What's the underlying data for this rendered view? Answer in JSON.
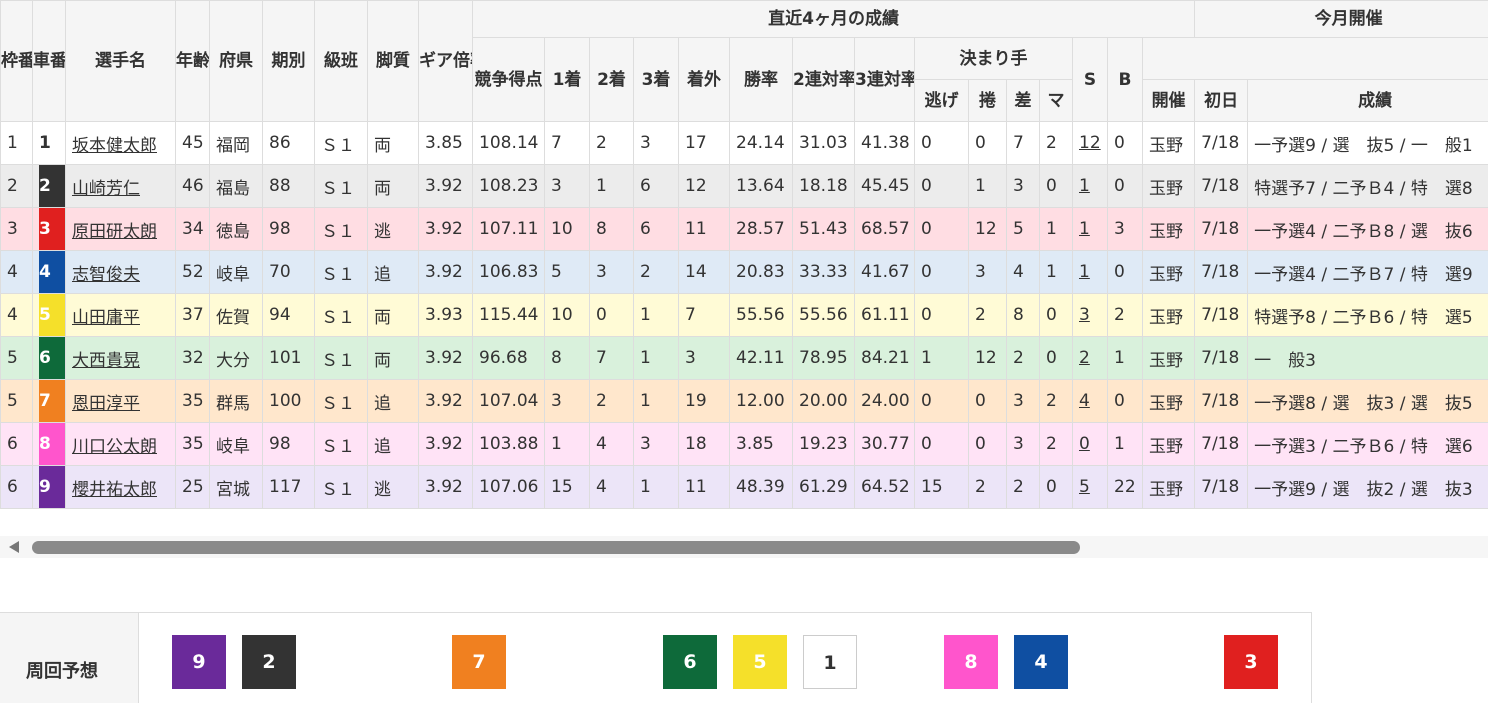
{
  "header": {
    "waku": "枠番",
    "sha": "車番",
    "name": "選手名",
    "age": "年齢",
    "pref": "府県",
    "term": "期別",
    "class": "級班",
    "style": "脚質",
    "gear": "ギア倍率",
    "recent": "直近4ヶ月の成績",
    "score": "競争得点",
    "first": "1着",
    "second": "2着",
    "third": "3着",
    "out": "着外",
    "win_rate": "勝率",
    "rate2": "2連対率",
    "rate3": "3連対率",
    "kimarite": "決まり手",
    "nige": "逃げ",
    "makuri": "捲",
    "sashi": "差",
    "mark": "マ",
    "s": "S",
    "b": "B",
    "month": "今月開催",
    "venue": "開催",
    "firstday": "初日",
    "result": "成績"
  },
  "colors": {
    "car1": "#ffffff",
    "car2": "#333333",
    "car3": "#e0201f",
    "car4": "#0f4fa2",
    "car5": "#f5e02a",
    "car6": "#0e6a3a",
    "car7": "#f08020",
    "car8": "#ff55cc",
    "car9": "#6a2a9a"
  },
  "racers": [
    {
      "waku": "1",
      "car": "1",
      "name": "坂本健太郎",
      "age": "45",
      "pref": "福岡",
      "term": "86",
      "class": "Ｓ１",
      "style": "両",
      "gear": "3.85",
      "score": "108.14",
      "first": "7",
      "second": "2",
      "third": "3",
      "out": "17",
      "win_rate": "24.14",
      "rate2": "31.03",
      "rate3": "41.38",
      "nige": "0",
      "makuri": "0",
      "sashi": "7",
      "mark": "2",
      "s": "12",
      "b": "0",
      "venue": "玉野",
      "firstday": "7/18",
      "result": "一予選9 / 選　抜5 / 一　般1"
    },
    {
      "waku": "2",
      "car": "2",
      "name": "山崎芳仁",
      "age": "46",
      "pref": "福島",
      "term": "88",
      "class": "Ｓ１",
      "style": "両",
      "gear": "3.92",
      "score": "108.23",
      "first": "3",
      "second": "1",
      "third": "6",
      "out": "12",
      "win_rate": "13.64",
      "rate2": "18.18",
      "rate3": "45.45",
      "nige": "0",
      "makuri": "1",
      "sashi": "3",
      "mark": "0",
      "s": "1",
      "b": "0",
      "venue": "玉野",
      "firstday": "7/18",
      "result": "特選予7 / 二予Ｂ4 / 特　選8"
    },
    {
      "waku": "3",
      "car": "3",
      "name": "原田研太朗",
      "age": "34",
      "pref": "徳島",
      "term": "98",
      "class": "Ｓ１",
      "style": "逃",
      "gear": "3.92",
      "score": "107.11",
      "first": "10",
      "second": "8",
      "third": "6",
      "out": "11",
      "win_rate": "28.57",
      "rate2": "51.43",
      "rate3": "68.57",
      "nige": "0",
      "makuri": "12",
      "sashi": "5",
      "mark": "1",
      "s": "1",
      "b": "3",
      "venue": "玉野",
      "firstday": "7/18",
      "result": "一予選4 / 二予Ｂ8 / 選　抜6"
    },
    {
      "waku": "4",
      "car": "4",
      "name": "志智俊夫",
      "age": "52",
      "pref": "岐阜",
      "term": "70",
      "class": "Ｓ１",
      "style": "追",
      "gear": "3.92",
      "score": "106.83",
      "first": "5",
      "second": "3",
      "third": "2",
      "out": "14",
      "win_rate": "20.83",
      "rate2": "33.33",
      "rate3": "41.67",
      "nige": "0",
      "makuri": "3",
      "sashi": "4",
      "mark": "1",
      "s": "1",
      "b": "0",
      "venue": "玉野",
      "firstday": "7/18",
      "result": "一予選4 / 二予Ｂ7 / 特　選9"
    },
    {
      "waku": "4",
      "car": "5",
      "name": "山田庸平",
      "age": "37",
      "pref": "佐賀",
      "term": "94",
      "class": "Ｓ１",
      "style": "両",
      "gear": "3.93",
      "score": "115.44",
      "first": "10",
      "second": "0",
      "third": "1",
      "out": "7",
      "win_rate": "55.56",
      "rate2": "55.56",
      "rate3": "61.11",
      "nige": "0",
      "makuri": "2",
      "sashi": "8",
      "mark": "0",
      "s": "3",
      "b": "2",
      "venue": "玉野",
      "firstday": "7/18",
      "result": "特選予8 / 二予Ｂ6 / 特　選5"
    },
    {
      "waku": "5",
      "car": "6",
      "name": "大西貴晃",
      "age": "32",
      "pref": "大分",
      "term": "101",
      "class": "Ｓ１",
      "style": "両",
      "gear": "3.92",
      "score": "96.68",
      "first": "8",
      "second": "7",
      "third": "1",
      "out": "3",
      "win_rate": "42.11",
      "rate2": "78.95",
      "rate3": "84.21",
      "nige": "1",
      "makuri": "12",
      "sashi": "2",
      "mark": "0",
      "s": "2",
      "b": "1",
      "venue": "玉野",
      "firstday": "7/18",
      "result": "一　般3"
    },
    {
      "waku": "5",
      "car": "7",
      "name": "恩田淳平",
      "age": "35",
      "pref": "群馬",
      "term": "100",
      "class": "Ｓ１",
      "style": "追",
      "gear": "3.92",
      "score": "107.04",
      "first": "3",
      "second": "2",
      "third": "1",
      "out": "19",
      "win_rate": "12.00",
      "rate2": "20.00",
      "rate3": "24.00",
      "nige": "0",
      "makuri": "0",
      "sashi": "3",
      "mark": "2",
      "s": "4",
      "b": "0",
      "venue": "玉野",
      "firstday": "7/18",
      "result": "一予選8 / 選　抜3 / 選　抜5"
    },
    {
      "waku": "6",
      "car": "8",
      "name": "川口公太朗",
      "age": "35",
      "pref": "岐阜",
      "term": "98",
      "class": "Ｓ１",
      "style": "追",
      "gear": "3.92",
      "score": "103.88",
      "first": "1",
      "second": "4",
      "third": "3",
      "out": "18",
      "win_rate": "3.85",
      "rate2": "19.23",
      "rate3": "30.77",
      "nige": "0",
      "makuri": "0",
      "sashi": "3",
      "mark": "2",
      "s": "0",
      "b": "1",
      "venue": "玉野",
      "firstday": "7/18",
      "result": "一予選3 / 二予Ｂ6 / 特　選6"
    },
    {
      "waku": "6",
      "car": "9",
      "name": "櫻井祐太郎",
      "age": "25",
      "pref": "宮城",
      "term": "117",
      "class": "Ｓ１",
      "style": "逃",
      "gear": "3.92",
      "score": "107.06",
      "first": "15",
      "second": "4",
      "third": "1",
      "out": "11",
      "win_rate": "48.39",
      "rate2": "61.29",
      "rate3": "64.52",
      "nige": "15",
      "makuri": "2",
      "sashi": "2",
      "mark": "0",
      "s": "5",
      "b": "22",
      "venue": "玉野",
      "firstday": "7/18",
      "result": "一予選9 / 選　抜2 / 選　抜3"
    }
  ],
  "prediction": {
    "label": "周回予想",
    "cars": [
      "9",
      "2",
      "7",
      "6",
      "5",
      "1",
      "8",
      "4",
      "3"
    ]
  }
}
